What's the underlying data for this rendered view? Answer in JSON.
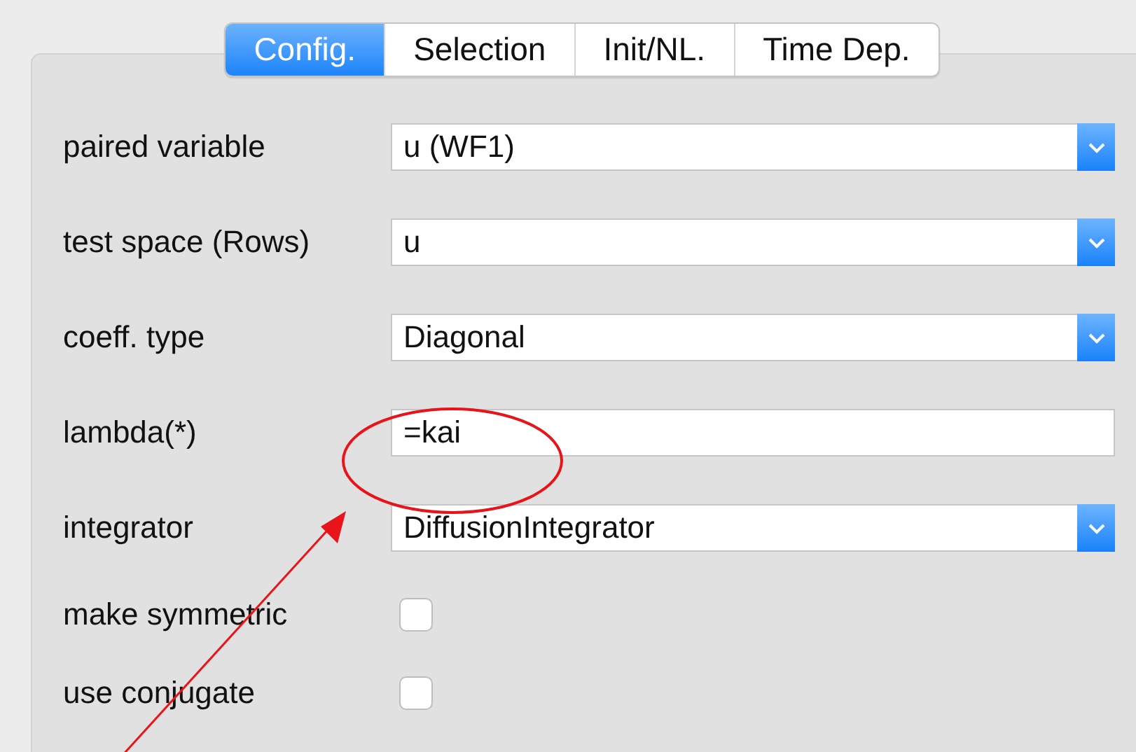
{
  "tabs": [
    {
      "label": "Config.",
      "selected": true
    },
    {
      "label": "Selection",
      "selected": false
    },
    {
      "label": "Init/NL.",
      "selected": false
    },
    {
      "label": "Time Dep.",
      "selected": false
    }
  ],
  "fields": [
    {
      "kind": "select",
      "label": "paired variable",
      "value": "u (WF1)"
    },
    {
      "kind": "select",
      "label": "test space (Rows)",
      "value": "u"
    },
    {
      "kind": "select",
      "label": "coeff. type",
      "value": "Diagonal"
    },
    {
      "kind": "text",
      "label": "lambda(*)",
      "value": "=kai"
    },
    {
      "kind": "select",
      "label": "integrator",
      "value": "DiffusionIntegrator"
    },
    {
      "kind": "checkbox",
      "label": "make symmetric",
      "checked": false
    },
    {
      "kind": "checkbox",
      "label": "use  conjugate",
      "checked": false
    }
  ]
}
